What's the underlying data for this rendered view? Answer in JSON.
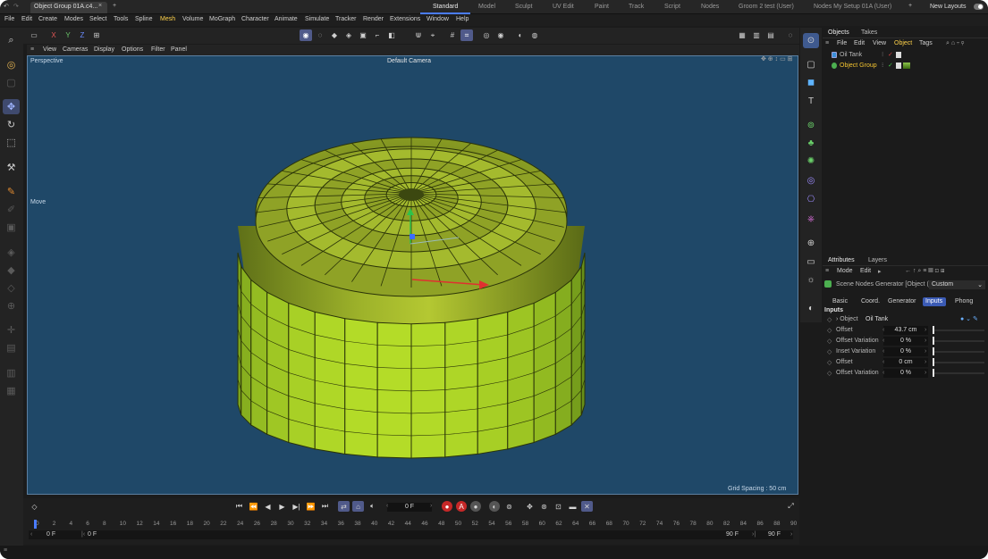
{
  "titlebar": {
    "doc_tab": "Object Group 01A.c4...",
    "close": "×",
    "plus": "+",
    "layouts": [
      "Standard",
      "Model",
      "Sculpt",
      "UV Edit",
      "Paint",
      "Track",
      "Script",
      "Nodes",
      "Groom 2 test (User)",
      "Nodes My Setup 01A (User)"
    ],
    "new_layouts": "New Layouts"
  },
  "menubar": [
    "File",
    "Edit",
    "Create",
    "Modes",
    "Select",
    "Tools",
    "Spline",
    "Mesh",
    "Volume",
    "MoGraph",
    "Character",
    "Animate",
    "Simulate",
    "Tracker",
    "Render",
    "Extensions",
    "Window",
    "Help"
  ],
  "toolbar": {
    "x": "X",
    "y": "Y",
    "z": "Z"
  },
  "viewport": {
    "menu": [
      "View",
      "Cameras",
      "Display",
      "Options",
      "Filter",
      "Panel"
    ],
    "projection": "Perspective",
    "camera": "Default Camera",
    "mode_label": "Move",
    "grid_spacing": "Grid Spacing : 50 cm"
  },
  "objects_panel": {
    "tabs": [
      "Objects",
      "Takes"
    ],
    "menu": [
      "File",
      "Edit",
      "View",
      "Object",
      "Tags"
    ],
    "items": [
      {
        "name": "Oil Tank",
        "color": "#9aa0d8"
      },
      {
        "name": "Object Group",
        "color": "#f4c430"
      }
    ]
  },
  "attributes_panel": {
    "tabs": [
      "Attributes",
      "Layers"
    ],
    "menu": [
      "Mode",
      "Edit"
    ],
    "node_title": "Scene Nodes Generator [Object (",
    "preset": "Custom",
    "subtabs": [
      "Basic",
      "Coord.",
      "Generator",
      "Inputs",
      "Phong"
    ],
    "active_subtab": "Inputs",
    "section": "Inputs",
    "object_label": "Object",
    "object_value": "Oil Tank",
    "params": [
      {
        "label": "Offset",
        "value": "43.7 cm"
      },
      {
        "label": "Offset Variation",
        "value": "0 %"
      },
      {
        "label": "Inset Variation",
        "value": "0 %"
      },
      {
        "label": "Offset",
        "value": "0 cm"
      },
      {
        "label": "Offset Variation",
        "value": "0 %"
      }
    ]
  },
  "timeline": {
    "frame": "0 F",
    "ticks": [
      "0",
      "2",
      "4",
      "6",
      "8",
      "10",
      "12",
      "14",
      "16",
      "18",
      "20",
      "22",
      "24",
      "26",
      "28",
      "30",
      "32",
      "34",
      "36",
      "38",
      "40",
      "42",
      "44",
      "46",
      "48",
      "50",
      "52",
      "54",
      "56",
      "58",
      "60",
      "62",
      "64",
      "66",
      "68",
      "70",
      "72",
      "74",
      "76",
      "78",
      "80",
      "82",
      "84",
      "86",
      "88",
      "90"
    ],
    "start_a": "0 F",
    "start_b": "0 F",
    "end_a": "90 F",
    "end_b": "90 F"
  }
}
